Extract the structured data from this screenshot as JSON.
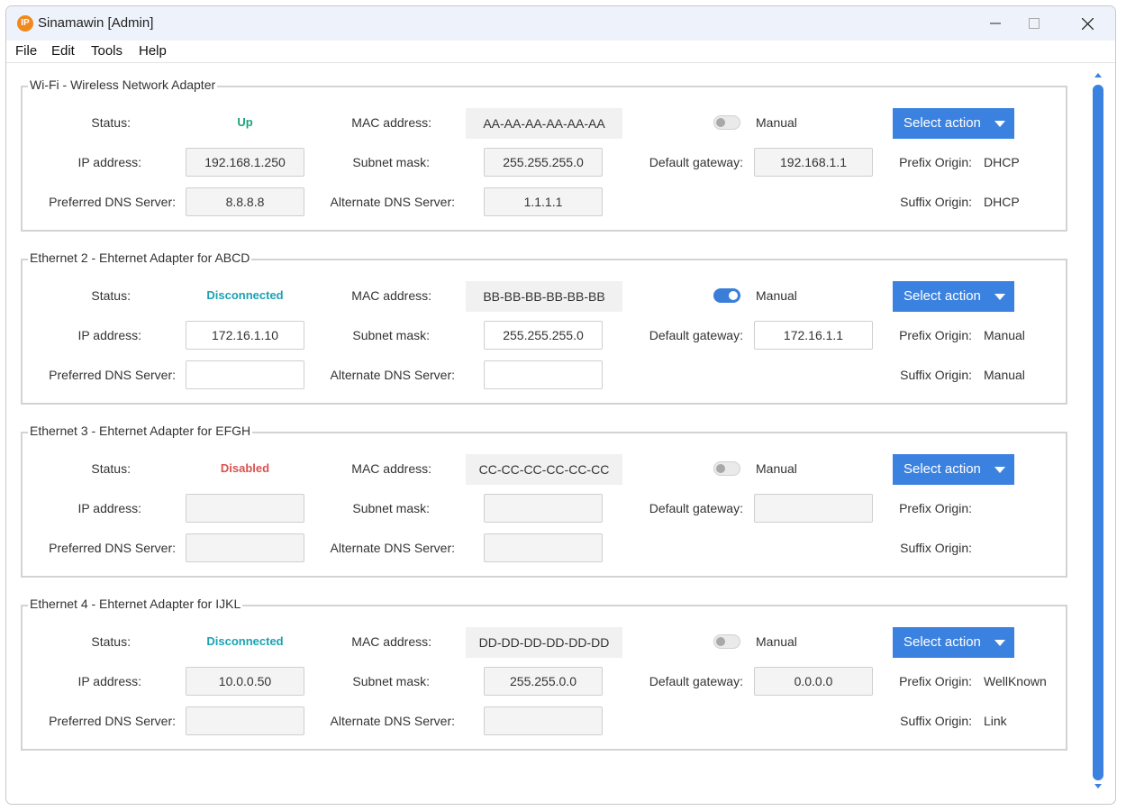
{
  "window": {
    "title": "Sinamawin [Admin]",
    "app_icon_glyph": "IP"
  },
  "menu": [
    "File",
    "Edit",
    "Tools",
    "Help"
  ],
  "colors": {
    "up": "#1aa37a",
    "disconnected": "#1aa3b3",
    "disabled": "#d9534f",
    "accent": "#3b82e0"
  },
  "labels": {
    "status": "Status:",
    "mac": "MAC address:",
    "manual": "Manual",
    "ip": "IP address:",
    "subnet": "Subnet mask:",
    "gateway": "Default gateway:",
    "pdns": "Preferred DNS Server:",
    "adns": "Alternate DNS Server:",
    "prefix": "Prefix Origin:",
    "suffix": "Suffix Origin:",
    "action": "Select action"
  },
  "adapters": [
    {
      "title": "Wi-Fi - Wireless Network Adapter",
      "status": "Up",
      "status_kind": "up",
      "mac": "AA-AA-AA-AA-AA-AA",
      "manual": false,
      "editable": false,
      "ip": "192.168.1.250",
      "subnet": "255.255.255.0",
      "gateway": "192.168.1.1",
      "pdns": "8.8.8.8",
      "adns": "1.1.1.1",
      "prefix": "DHCP",
      "suffix": "DHCP"
    },
    {
      "title": "Ethernet 2 - Ehternet Adapter for ABCD",
      "status": "Disconnected",
      "status_kind": "disconnected",
      "mac": "BB-BB-BB-BB-BB-BB",
      "manual": true,
      "editable": true,
      "ip": "172.16.1.10",
      "subnet": "255.255.255.0",
      "gateway": "172.16.1.1",
      "pdns": "",
      "adns": "",
      "prefix": "Manual",
      "suffix": "Manual"
    },
    {
      "title": "Ethernet 3 - Ehternet Adapter for EFGH",
      "status": "Disabled",
      "status_kind": "disabled",
      "mac": "CC-CC-CC-CC-CC-CC",
      "manual": false,
      "editable": false,
      "ip": "",
      "subnet": "",
      "gateway": "",
      "pdns": "",
      "adns": "",
      "prefix": "",
      "suffix": ""
    },
    {
      "title": "Ethernet 4 - Ehternet Adapter for IJKL",
      "status": "Disconnected",
      "status_kind": "disconnected",
      "mac": "DD-DD-DD-DD-DD-DD",
      "manual": false,
      "editable": false,
      "ip": "10.0.0.50",
      "subnet": "255.255.0.0",
      "gateway": "0.0.0.0",
      "pdns": "",
      "adns": "",
      "prefix": "WellKnown",
      "suffix": "Link"
    }
  ]
}
